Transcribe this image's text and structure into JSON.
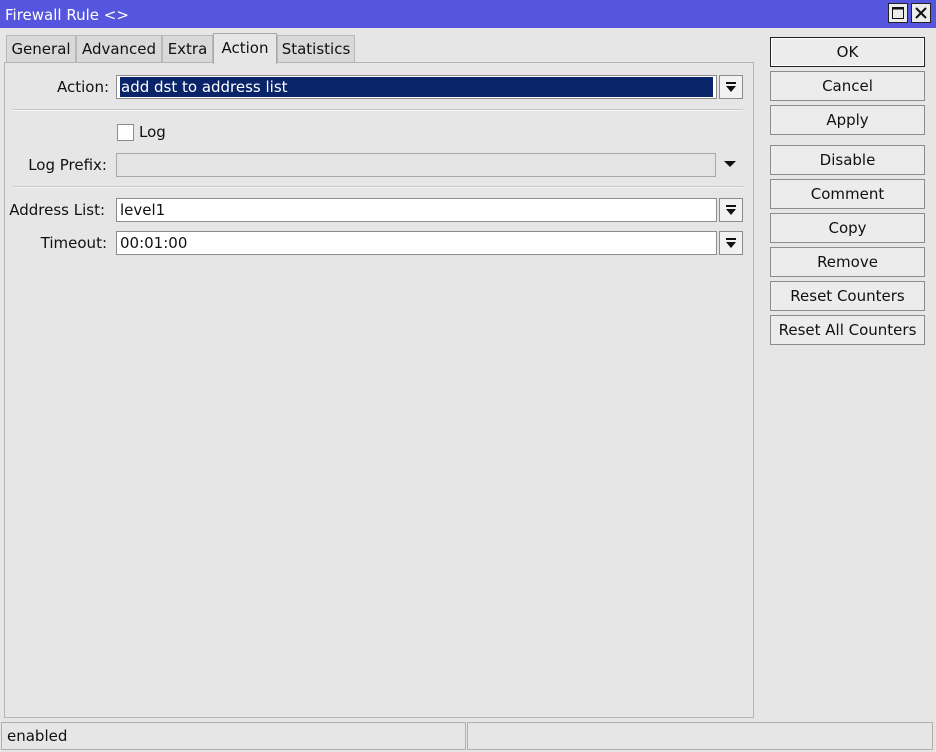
{
  "window": {
    "title": "Firewall Rule <>",
    "maximize_icon": "maximize-icon",
    "close_icon": "close-icon"
  },
  "tabs": [
    {
      "label": "General",
      "active": false
    },
    {
      "label": "Advanced",
      "active": false
    },
    {
      "label": "Extra",
      "active": false
    },
    {
      "label": "Action",
      "active": true
    },
    {
      "label": "Statistics",
      "active": false
    }
  ],
  "form": {
    "action": {
      "label": "Action:",
      "value": "add dst to address list"
    },
    "log": {
      "label": "Log",
      "checked": false
    },
    "log_prefix": {
      "label": "Log Prefix:",
      "value": ""
    },
    "address_list": {
      "label": "Address List:",
      "value": "level1"
    },
    "timeout": {
      "label": "Timeout:",
      "value": "00:01:00"
    }
  },
  "buttons": {
    "ok": "OK",
    "cancel": "Cancel",
    "apply": "Apply",
    "disable": "Disable",
    "comment": "Comment",
    "copy": "Copy",
    "remove": "Remove",
    "reset_counters": "Reset Counters",
    "reset_all_counters": "Reset All Counters"
  },
  "status": {
    "left": "enabled",
    "right": ""
  },
  "colors": {
    "titlebar": "#5555dd",
    "selection": "#0a246a"
  }
}
